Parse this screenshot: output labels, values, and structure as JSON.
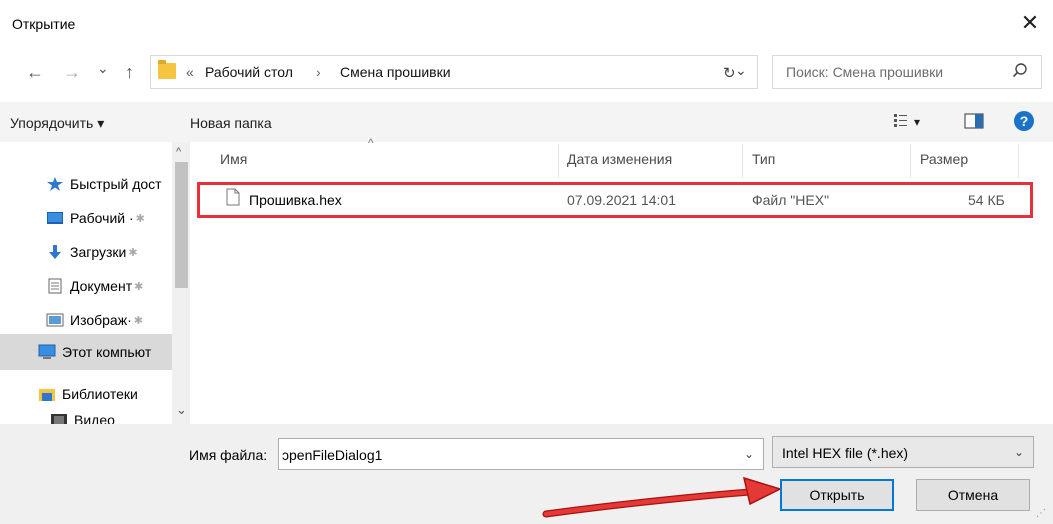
{
  "window": {
    "title": "Открытие",
    "close_glyph": "✕"
  },
  "nav": {
    "back_glyph": "←",
    "forward_glyph": "→",
    "recent_glyph": "⌄",
    "up_glyph": "↑",
    "breadcrumb_overflow": "«",
    "breadcrumb": [
      "Рабочий стол",
      "Смена прошивки"
    ],
    "breadcrumb_sep": "›",
    "addr_drop_glyph": "⌄",
    "refresh_glyph": "↻",
    "search_placeholder": "Поиск: Смена прошивки"
  },
  "toolbar": {
    "organize_label": "Упорядочить ▾",
    "new_folder_label": "Новая папка",
    "view_glyph": "▾",
    "help_glyph": "?"
  },
  "sidebar": {
    "items": [
      {
        "label": "Быстрый дост",
        "icon": "star-icon"
      },
      {
        "label": "Рабочий ·",
        "icon": "desktop-icon",
        "pin": "✱"
      },
      {
        "label": "Загрузки",
        "icon": "download-icon",
        "pin": "✱"
      },
      {
        "label": "Документ",
        "icon": "document-icon",
        "pin": "✱"
      },
      {
        "label": "Изображ·",
        "icon": "image-icon",
        "pin": "✱"
      },
      {
        "label": "Этот компьют",
        "icon": "computer-icon"
      },
      {
        "label": "Библиотеки",
        "icon": "library-icon"
      },
      {
        "label": "Видео",
        "icon": "video-icon"
      }
    ],
    "scroll_up": "^",
    "scroll_down": "⌄"
  },
  "files": {
    "columns": [
      "Имя",
      "Дата изменения",
      "Тип",
      "Размер"
    ],
    "sort_glyph": "^",
    "rows": [
      {
        "name": "Прошивка.hex",
        "date": "07.09.2021 14:01",
        "type": "Файл \"HEX\"",
        "size": "54 КБ"
      }
    ]
  },
  "footer": {
    "filename_label": "Имя файла:",
    "filename_value": "ɔpenFileDialog1",
    "filename_drop": "⌄",
    "filter_value": "Intel HEX file (*.hex)",
    "filter_drop": "⌄",
    "open_label": "Открыть",
    "cancel_label": "Отмена"
  },
  "colors": {
    "highlight": "#e8303a",
    "arrow": "#d9232d",
    "accent": "#0078d7"
  }
}
